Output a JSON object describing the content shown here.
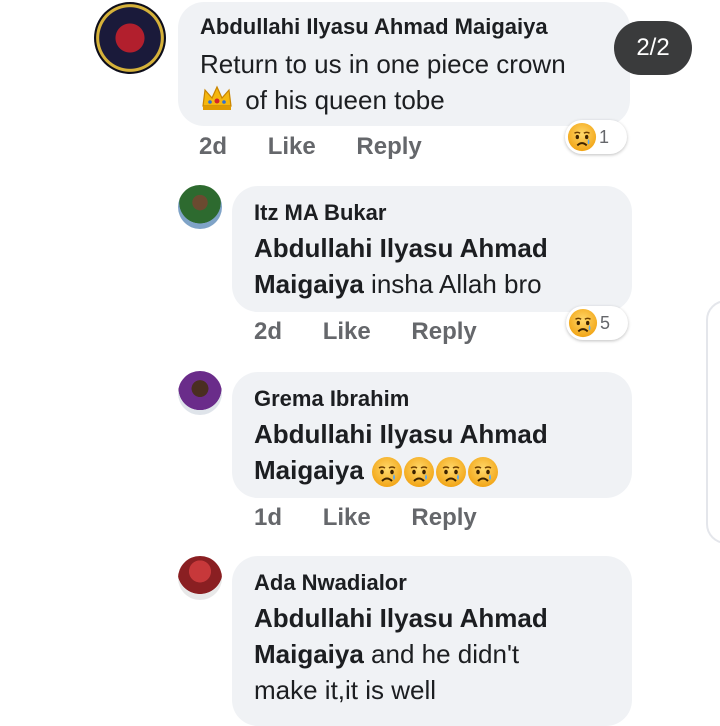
{
  "pager": {
    "label": "2/2"
  },
  "comments": [
    {
      "author": "Abdullahi Ilyasu Ahmad Maigaiya",
      "line1": "Return to us in one piece crown",
      "line2": "of his queen tobe",
      "time": "2d",
      "like": "Like",
      "reply": "Reply",
      "reaction_icon": "sad-face-icon",
      "reaction_count": "1"
    },
    {
      "author": "Itz MA Bukar",
      "mention1": "Abdullahi Ilyasu Ahmad",
      "mention2": "Maigaiya",
      "rest": " insha Allah bro",
      "time": "2d",
      "like": "Like",
      "reply": "Reply",
      "reaction_icon": "sad-face-icon",
      "reaction_count": "5"
    },
    {
      "author": "Grema Ibrahim",
      "mention1": "Abdullahi Ilyasu Ahmad",
      "mention2": "Maigaiya",
      "emoji_icon": "sad-face-icon",
      "time": "1d",
      "like": "Like",
      "reply": "Reply"
    },
    {
      "author": "Ada Nwadialor",
      "mention1": "Abdullahi Ilyasu Ahmad",
      "mention2": "Maigaiya",
      "rest": " and he didn't",
      "line3": "make it,it is well"
    }
  ],
  "colors": {
    "bubble": "#f0f2f5",
    "meta": "#65676b",
    "text": "#1c1e21",
    "sad": "#f7b125"
  }
}
